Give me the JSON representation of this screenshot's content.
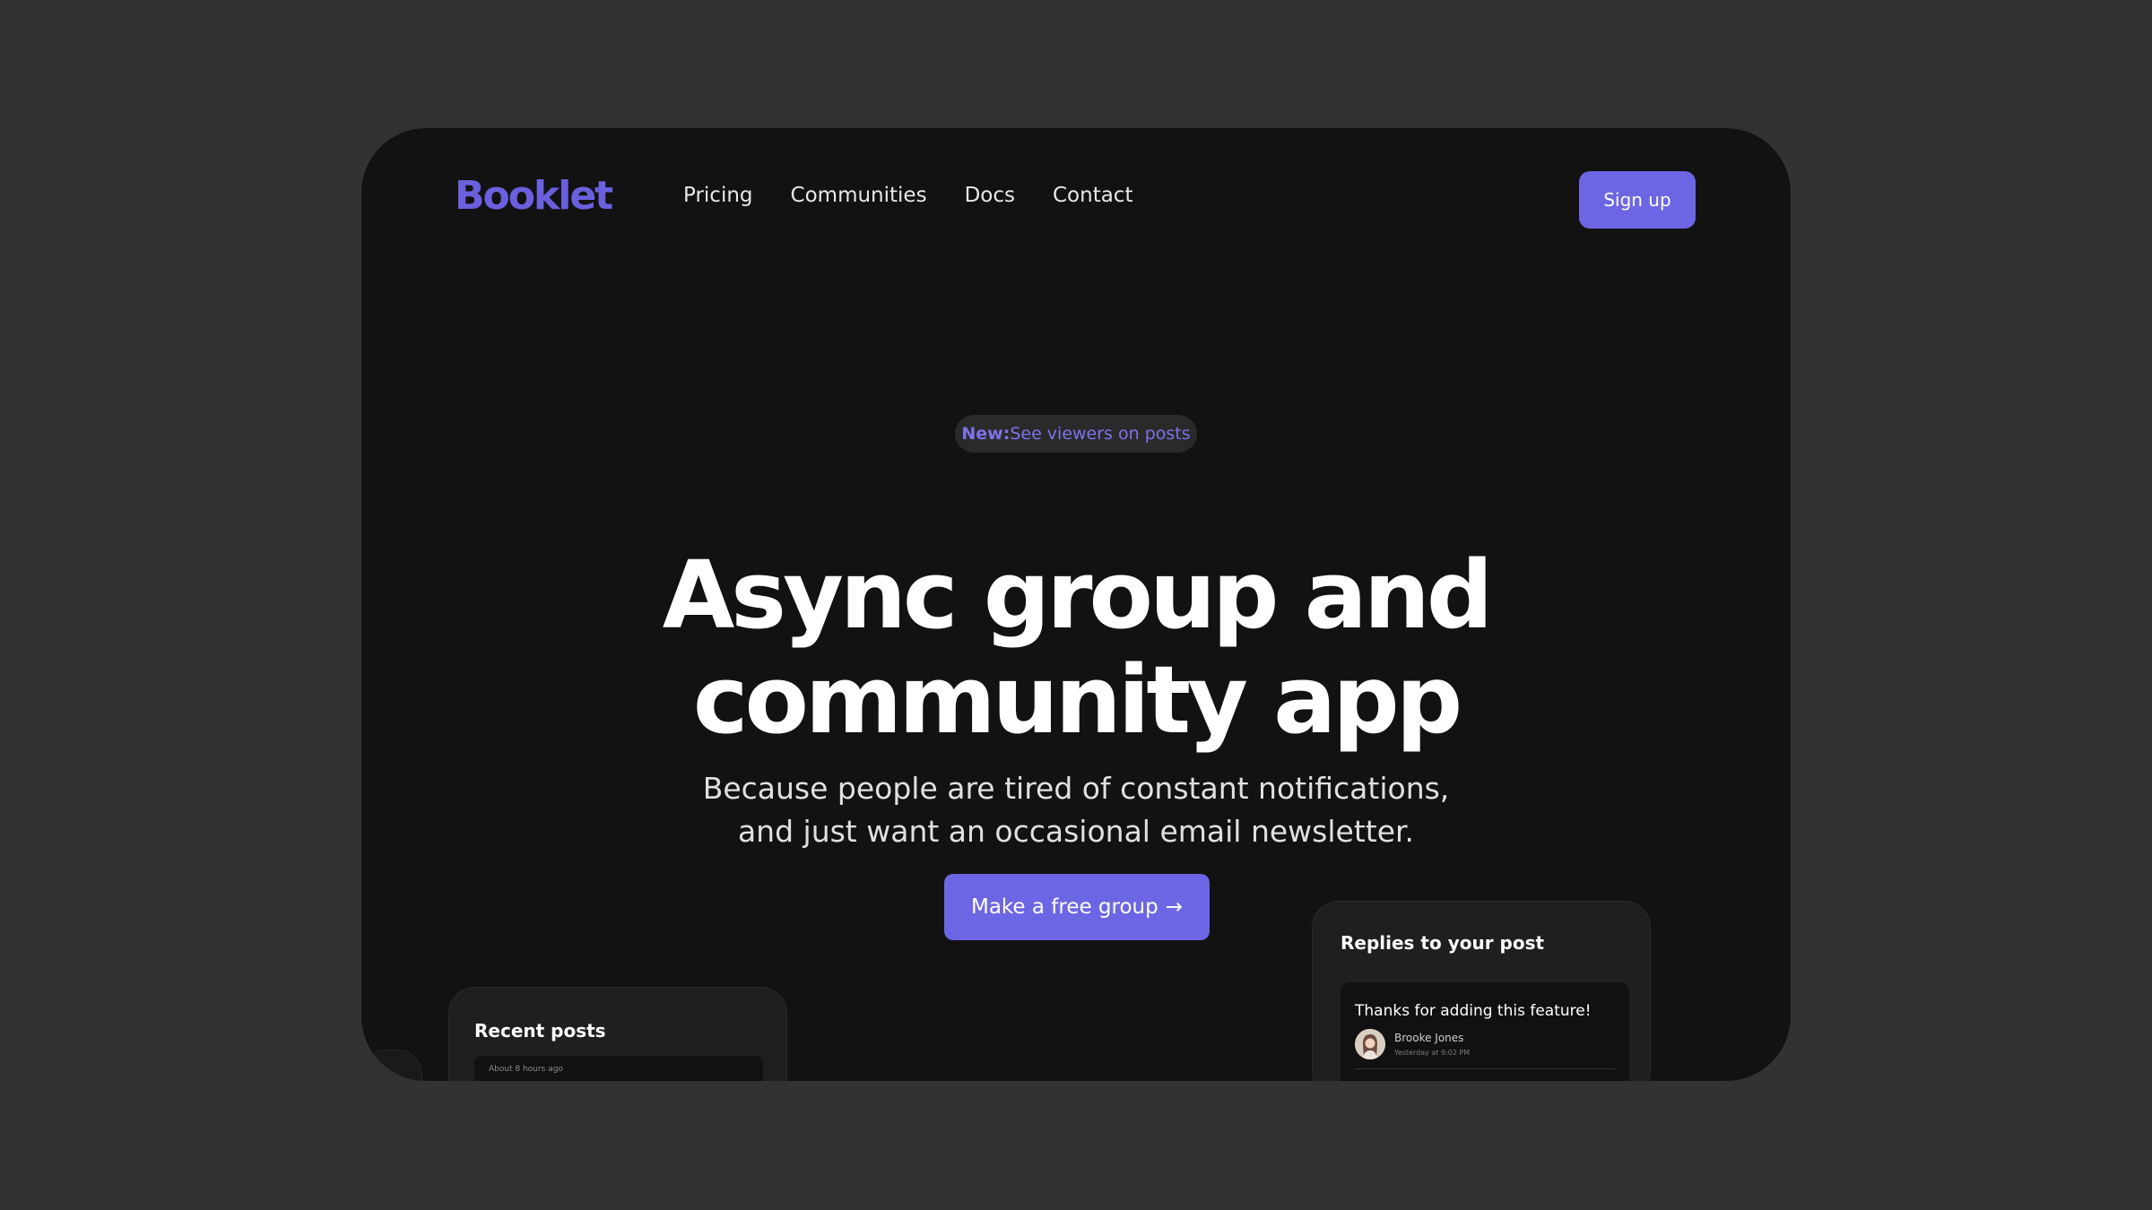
{
  "brand": {
    "name": "Booklet",
    "accent_color": "#6D66E4",
    "background_color": "#121212"
  },
  "nav": {
    "items": [
      {
        "label": "Pricing"
      },
      {
        "label": "Communities"
      },
      {
        "label": "Docs"
      },
      {
        "label": "Contact"
      }
    ],
    "signup_label": "Sign up"
  },
  "hero": {
    "announcement": {
      "prefix": "New:",
      "text": " See viewers on posts"
    },
    "title_line_1": "Async group and",
    "title_line_2": "community app",
    "subtitle_line_1": "Because people are tired of constant notifications,",
    "subtitle_line_2": "and just want an occasional email newsletter.",
    "cta_label": "Make a free group",
    "cta_icon": "arrow-right-icon"
  },
  "recent_posts": {
    "title": "Recent posts",
    "items": [
      {
        "meta": "About 8 hours ago"
      }
    ]
  },
  "replies": {
    "title": "Replies to your post",
    "items": [
      {
        "text": "Thanks for adding this feature!",
        "author": "Brooke Jones",
        "time": "Yesterday at 9:02 PM"
      }
    ]
  }
}
